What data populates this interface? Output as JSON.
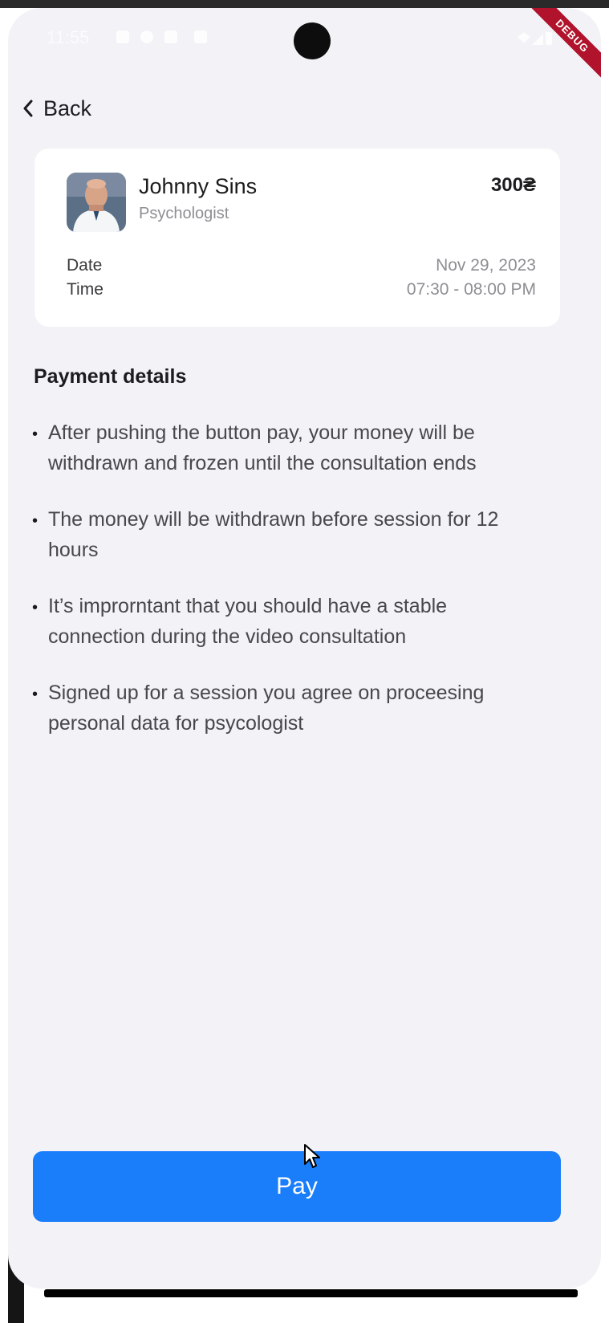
{
  "status_bar": {
    "time": "11:55",
    "debug_label": "DEBUG"
  },
  "nav": {
    "back_label": "Back",
    "back_icon": "chevron-left-icon"
  },
  "appointment": {
    "doctor_name": "Johnny Sins",
    "doctor_role": "Psychologist",
    "price": "300₴",
    "date_label": "Date",
    "date_value": "Nov 29, 2023",
    "time_label": "Time",
    "time_value": "07:30 - 08:00 PM"
  },
  "payment_details": {
    "title": "Payment details",
    "items": [
      "After pushing the button pay, your money will be withdrawn and frozen until the consultation ends",
      "The money will be withdrawn before session for 12 hours",
      "It’s improrntant that you should have a stable connection during the video consultation",
      "Signed up for a session you agree on proceesing personal data for psycologist"
    ]
  },
  "actions": {
    "pay_label": "Pay"
  },
  "colors": {
    "primary": "#1a7dfa",
    "background": "#f2f2f7",
    "card": "#ffffff",
    "debug": "#b0132b"
  }
}
